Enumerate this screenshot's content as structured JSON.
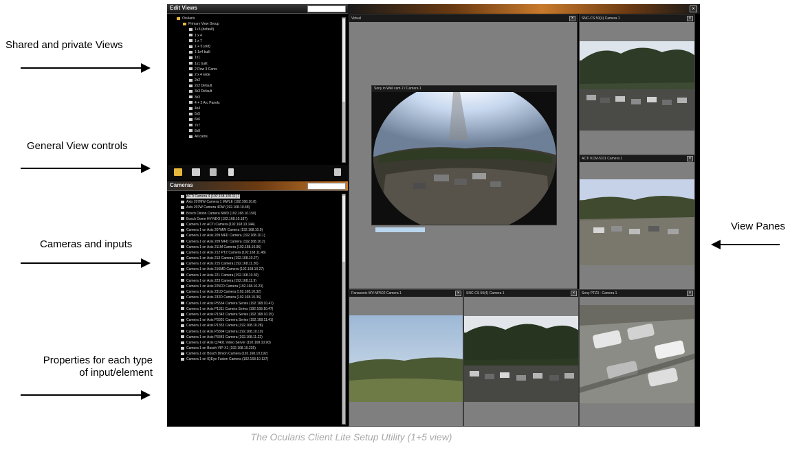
{
  "annotations": {
    "shared_views": "Shared and private Views",
    "general_controls": "General View controls",
    "cameras_inputs": "Cameras and inputs",
    "properties_line1": "Properties for each type",
    "properties_line2": "of input/element",
    "view_panes": "View Panes"
  },
  "caption": "The Ocularis Client Lite Setup Utility (1+5 view)",
  "views_panel": {
    "title": "Edit Views",
    "items": [
      {
        "label": "Ocularis",
        "level": 0,
        "icon": "folder-icon"
      },
      {
        "label": "Primary View Group",
        "level": 1,
        "icon": "folder-icon"
      },
      {
        "label": "1+5 (default)",
        "level": 2,
        "icon": "view-icon"
      },
      {
        "label": "1 x 4",
        "level": 2,
        "icon": "view-icon"
      },
      {
        "label": "1 x 7",
        "level": 2,
        "icon": "view-icon"
      },
      {
        "label": "1 + 5 (old)",
        "level": 2,
        "icon": "view-icon"
      },
      {
        "label": "1 1x4 built",
        "level": 2,
        "icon": "view-icon"
      },
      {
        "label": "1x1",
        "level": 2,
        "icon": "view-icon"
      },
      {
        "label": "1x1 built",
        "level": 2,
        "icon": "view-icon"
      },
      {
        "label": "2 Row 3 Cams",
        "level": 2,
        "icon": "view-icon"
      },
      {
        "label": "2 x 4 wide",
        "level": 2,
        "icon": "view-icon"
      },
      {
        "label": "2x2",
        "level": 2,
        "icon": "view-icon"
      },
      {
        "label": "2x2 Default",
        "level": 2,
        "icon": "view-icon"
      },
      {
        "label": "3x3 Default",
        "level": 2,
        "icon": "view-icon"
      },
      {
        "label": "3x3",
        "level": 2,
        "icon": "view-icon"
      },
      {
        "label": "4 + 2 Arc Panels",
        "level": 2,
        "icon": "view-icon"
      },
      {
        "label": "4x4",
        "level": 2,
        "icon": "view-icon"
      },
      {
        "label": "5x5",
        "level": 2,
        "icon": "view-icon"
      },
      {
        "label": "6x6",
        "level": 2,
        "icon": "view-icon"
      },
      {
        "label": "7x7",
        "level": 2,
        "icon": "view-icon"
      },
      {
        "label": "8x8",
        "level": 2,
        "icon": "view-icon"
      },
      {
        "label": "All cams",
        "level": 2,
        "icon": "view-icon"
      }
    ]
  },
  "toolbar": {
    "buttons": [
      "folder-icon",
      "new-view-icon",
      "edit-icon",
      "delete-icon",
      "save-icon"
    ]
  },
  "cameras_panel": {
    "title": "Cameras",
    "items": [
      {
        "label": "ACTi Camera 4 (192.168.100.11) 1",
        "selected": true
      },
      {
        "label": "Axis 207MW Camera 1 MWLE (192.168.10.8)"
      },
      {
        "label": "Axis 207W Camera 4DW (192.168.10.48)"
      },
      {
        "label": "Bosch Dinion Camera NWD (192.168.10.150)"
      },
      {
        "label": "Bosch Dome HY-NDO (192.168.10.187)"
      },
      {
        "label": "Camera 1 on ACTi Camera (192.168.10.144)"
      },
      {
        "label": "Camera 1 on Axis 207MW Camera (192.168.10.9)"
      },
      {
        "label": "Camera 1 on Axis 209 MFD Camera (192.168.10.1)"
      },
      {
        "label": "Camera 1 on Axis 209 MFD Camera (192.168.10.2)"
      },
      {
        "label": "Camera 1 on Axis 211M Camera (192.168.10.96)"
      },
      {
        "label": "Camera 1 on Axis 212 PTZ Camera (192.168.11.48)"
      },
      {
        "label": "Camera 1 on Axis 213 Camera (192.168.10.27)"
      },
      {
        "label": "Camera 1 on Axis 215 Camera (192.168.11.20)"
      },
      {
        "label": "Camera 1 on Axis 216MD Camera (192.168.10.27)"
      },
      {
        "label": "Camera 1 on Axis 221 Camera (192.168.10.30)"
      },
      {
        "label": "Camera 1 on Axis 223 Camera (192.168.11.9)"
      },
      {
        "label": "Camera 1 on Axis 225FD Camera (192.168.10.23)"
      },
      {
        "label": "Camera 1 on Axis 231D Camera (192.168.10.32)"
      },
      {
        "label": "Camera 1 on Axis 232D Camera (192.168.10.36)"
      },
      {
        "label": "Camera 1 on Axis P5534 Camera Series (192.168.10.47)"
      },
      {
        "label": "Camera 1 on Axis P1311 Camera Series (192.168.10.47)"
      },
      {
        "label": "Camera 1 on Axis P1343 Camera Series (192.168.10.25)"
      },
      {
        "label": "Camera 1 on Axis P3301 Camera Series (192.168.11.41)"
      },
      {
        "label": "Camera 1 on Axis P1353 Camera (192.168.10.28)"
      },
      {
        "label": "Camera 1 on Axis P3304 Camera (192.168.10.10)"
      },
      {
        "label": "Camera 1 on Axis P3343 Camera (192.168.11.22)"
      },
      {
        "label": "Camera 1 on Axis Q7401 Video Server (192.168.10.90)"
      },
      {
        "label": "Camera 1 on Bosch VIP-X1 (192.168.10.235)"
      },
      {
        "label": "Camera 1 on Bosch Dinion Camera (192.168.10.192)"
      },
      {
        "label": "Camera 1 on IQEye Fusion Camera (192.168.10.137)"
      }
    ]
  },
  "view_panes": {
    "main": {
      "title": "Virtual"
    },
    "main_feed": {
      "title": "Sony in Wall cam 2 / Camera 1"
    },
    "right_top": {
      "title": "SNC-CS 50(4) Camera 1"
    },
    "right_mid": {
      "title": "ACTi KCM-5311 Camera 1"
    },
    "bottom_1": {
      "title": "Panasonic WV-NP502 Camera 1"
    },
    "bottom_2": {
      "title": "SNC-CS 50(4) Camera 1"
    },
    "bottom_3": {
      "title": "Sony PTZ3 - Camera 1"
    }
  },
  "colors": {
    "accent_orange": "#c87a2c",
    "pane_gray": "#7f7f7f",
    "folder_yellow": "#e5b73b"
  }
}
